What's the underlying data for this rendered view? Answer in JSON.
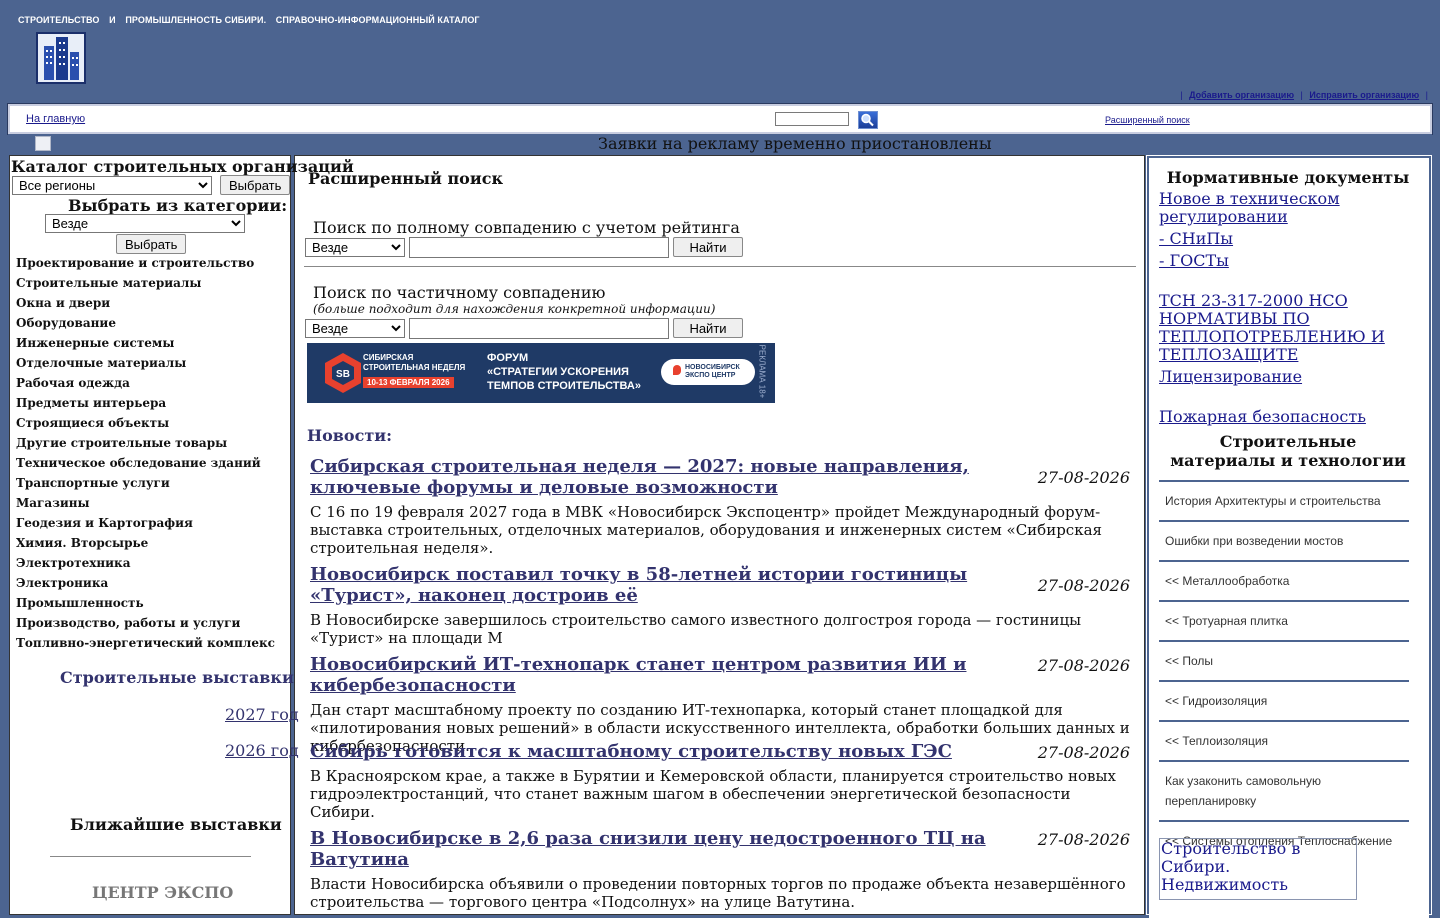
{
  "header": {
    "title_parts": [
      "СТРОИТЕЛЬСТВО",
      "И",
      "ПРОМЫШЛЕННОСТЬ СИБИРИ.",
      "СПРАВОЧНО-ИНФОРМАЦИОННЫЙ КАТАЛОГ"
    ],
    "links": [
      "Добавить организацию",
      "Исправить организацию"
    ],
    "separator": "|"
  },
  "navbar": {
    "home": "На главную",
    "search_value": "",
    "advanced": "Расширенный поиск"
  },
  "ad_notice": "Заявки на рекламу временно приостановлены",
  "left": {
    "catalog_title": "Каталог строительных организаций",
    "region_select": "Все регионы",
    "choose_button": "Выбрать",
    "category_title": "Выбрать из категории:",
    "category_select": "Везде",
    "choose_button2": "Выбрать",
    "categories": [
      "Проектирование и строительство",
      "Строительные материалы",
      "Окна и двери",
      "Оборудование",
      "Инженерные системы",
      "Отделочные материалы",
      "Рабочая одежда",
      "Предметы интерьера",
      "Строящиеся объекты",
      "Другие строительные товары",
      "Техническое обследование зданий",
      "Транспортные услуги",
      "Магазины",
      "Геодезия и Картография",
      "Химия. Вторсырье",
      "Электротехника",
      "Электроника",
      "Промышленность",
      "Производство, работы и услуги",
      "Топливно-энергетический комплекс"
    ],
    "exhibitions_title": "Строительные выставки",
    "exhibition_years": [
      "2027 год",
      "2026 год"
    ],
    "nearest_title": "Ближайшие выставки",
    "expo_name": "ЦЕНТР ЭКСПО"
  },
  "middle": {
    "title": "Расширенный поиск",
    "full_match_label": "Поиск по полному совпадению с учетом рейтинга",
    "partial_label": "Поиск по частичному совпадению",
    "partial_hint": "(больше подходит для нахождения конкретной информации)",
    "scope_select": "Везде",
    "find_button": "Найти",
    "banner": {
      "left_line1": "СИБИРСКАЯ",
      "left_line2": "СТРОИТЕЛЬНАЯ НЕДЕЛЯ",
      "dates": "10-13 ФЕВРАЛЯ 2026",
      "forum_line1": "ФОРУМ",
      "forum_line2": "«СТРАТЕГИИ УСКОРЕНИЯ",
      "forum_line3": "ТЕМПОВ СТРОИТЕЛЬСТВА»",
      "badge": "НОВОСИБИРСК ЭКСПО ЦЕНТР",
      "side_text": "РЕКЛАМА 18+"
    },
    "news_title": "Новости:",
    "news": [
      {
        "title": "Сибирская строительная неделя — 2027: новые направления, ключевые форумы и деловые возможности",
        "date": "27-08-2026",
        "text": "С 16 по 19 февраля 2027 года в МВК «Новосибирск Экспоцентр» пройдет Международный форум-выставка строительных, отделочных материалов, оборудования и инженерных систем «Сибирская строительная неделя»."
      },
      {
        "title": "Новосибирск поставил точку в 58-летней истории гостиницы «Турист», наконец достроив её",
        "date": "27-08-2026",
        "text": "В Новосибирске завершилось строительство самого известного долгостроя города — гостиницы «Турист» на площади М"
      },
      {
        "title": "Новосибирский ИТ-технопарк станет центром развития ИИ и кибербезопасности",
        "date": "27-08-2026",
        "text": "Дан старт масштабному проекту по созданию ИТ-технопарка, который станет площадкой для «пилотирования новых решений» в области искусственного интеллекта, обработки больших данных и кибербезопасности."
      },
      {
        "title": "Сибирь готовится к масштабному строительству новых ГЭС",
        "date": "27-08-2026",
        "text": "В Красноярском крае, а также в Бурятии и Кемеровской области, планируется строительство новых гидроэлектростанций, что станет важным шагом в обеспечении энергетической безопасности Сибири."
      },
      {
        "title": "В Новосибирске в 2,6 раза снизили цену недостроенного ТЦ на Ватутина",
        "date": "27-08-2026",
        "text": "Власти Новосибирска объявили о проведении повторных торгов по продаже объекта незавершённого строительства — торгового центра «Подсолнух» на улице Ватутина."
      }
    ]
  },
  "right": {
    "norm_title": "Нормативные документы",
    "norm_links": [
      "Новое в техническом регулировании",
      "- СНиПы",
      "- ГОСТы",
      "",
      "ТСН 23-317-2000 НСО НОРМАТИВЫ ПО ТЕПЛОПОТРЕБЛЕНИЮ И ТЕПЛОЗАЩИТЕ",
      "Лицензирование",
      "",
      "Пожарная безопасность"
    ],
    "materials_title": "Строительные материалы и технологии",
    "menu": [
      "История Архитектуры и строительства",
      "Ошибки при возведении мостов",
      "<< Металлообработка",
      "<< Тротуарная плитка",
      "<< Полы",
      "<< Гидроизоляция",
      "<< Теплоизоляция",
      "Как узаконить самовольную перепланировку",
      "<< Системы отопления Теплоснабжение"
    ],
    "image_alt": "Строительство в Сибири. Недвижимость"
  }
}
